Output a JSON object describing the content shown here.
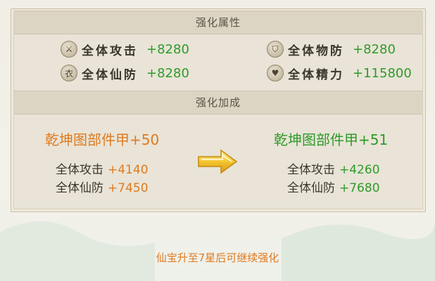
{
  "sections": {
    "attributes_title": "强化属性",
    "bonus_title": "强化加成"
  },
  "attributes": [
    {
      "icon": "sword-icon",
      "label": "全体攻击",
      "value": "+8280"
    },
    {
      "icon": "shield-icon",
      "label": "全体物防",
      "value": "+8280"
    },
    {
      "icon": "robe-icon",
      "label": "全体仙防",
      "value": "+8280"
    },
    {
      "icon": "heart-icon",
      "label": "全体精力",
      "value": "+115800"
    }
  ],
  "current": {
    "title": "乾坤图部件甲+50",
    "lines": [
      {
        "label": "全体攻击",
        "value": "+4140"
      },
      {
        "label": "全体仙防",
        "value": "+7450"
      }
    ]
  },
  "next": {
    "title": "乾坤图部件甲+51",
    "lines": [
      {
        "label": "全体攻击",
        "value": "+4260"
      },
      {
        "label": "全体仙防",
        "value": "+7680"
      }
    ]
  },
  "footer_note": "仙宝升至7星后可继续强化",
  "colors": {
    "accent_orange": "#e07a1f",
    "accent_green": "#2f9a2a",
    "panel_bg": "#e9e4d7"
  }
}
